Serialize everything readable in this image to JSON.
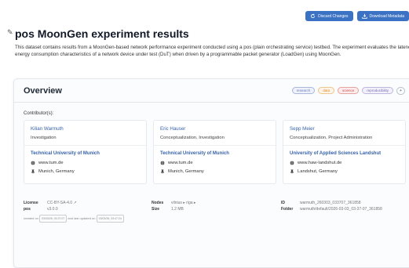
{
  "toolbar": {
    "discard_label": "Discard Changes",
    "download_label": "Download Metadata",
    "accent": "#3b72c4"
  },
  "page": {
    "title": "pos MoonGen experiment results",
    "description": "This dataset contains results from a MoonGen-based network performance experiment conducted using a pos (plain orchestrating service) testbed. The experiment evaluates the latency and energy consumption characteristics of a network device under test (DuT) when driven by a programmable packet generator (LoadGen) using MoonGen."
  },
  "overview": {
    "title": "Overview",
    "tags": [
      {
        "label": "research",
        "color": "#6b7fbf"
      },
      {
        "label": "data",
        "color": "#d98b2b"
      },
      {
        "label": "science",
        "color": "#c9504c"
      },
      {
        "label": "reproducibility",
        "color": "#7a6fb5"
      }
    ],
    "tags_more": "+",
    "contributors_label": "Contributor(s):",
    "contributors": [
      {
        "name": "Kilian Warmuth",
        "role": "Investigation",
        "org": "Technical University of Munich",
        "website": "www.tum.de",
        "location": "Munich, Germany"
      },
      {
        "name": "Eric Hauser",
        "role": "Conceptualization, Investigation",
        "org": "Technical University of Munich",
        "website": "www.tum.de",
        "location": "Munich, Germany"
      },
      {
        "name": "Sepp Meier",
        "role": "Conceptualization, Project Administration",
        "org": "University of Applied Sciences Landshut",
        "website": "www.haw-landshut.de",
        "location": "Landshut, Germany"
      }
    ]
  },
  "meta": {
    "license_key": "License",
    "license_value": "CC-BY-SA-4.0 ↗",
    "pos_key": "pos",
    "pos_value": "v3.0.0",
    "nodes_key": "Nodes",
    "nodes_value": "vilnius ▸  riga ▸",
    "size_key": "Size",
    "size_value": "1.2 MB",
    "id_key": "ID",
    "id_value": "warmuth_260303_033707_361858",
    "folder_key": "Folder",
    "folder_value": "warmuth/default/2026-03-03_03-37-07_361858",
    "created_prefix": "created on",
    "created_date": "03/03/26, 03:37:07",
    "updated_prefix": "and last updated on",
    "updated_date": "03/03/26, 03:47:24"
  }
}
